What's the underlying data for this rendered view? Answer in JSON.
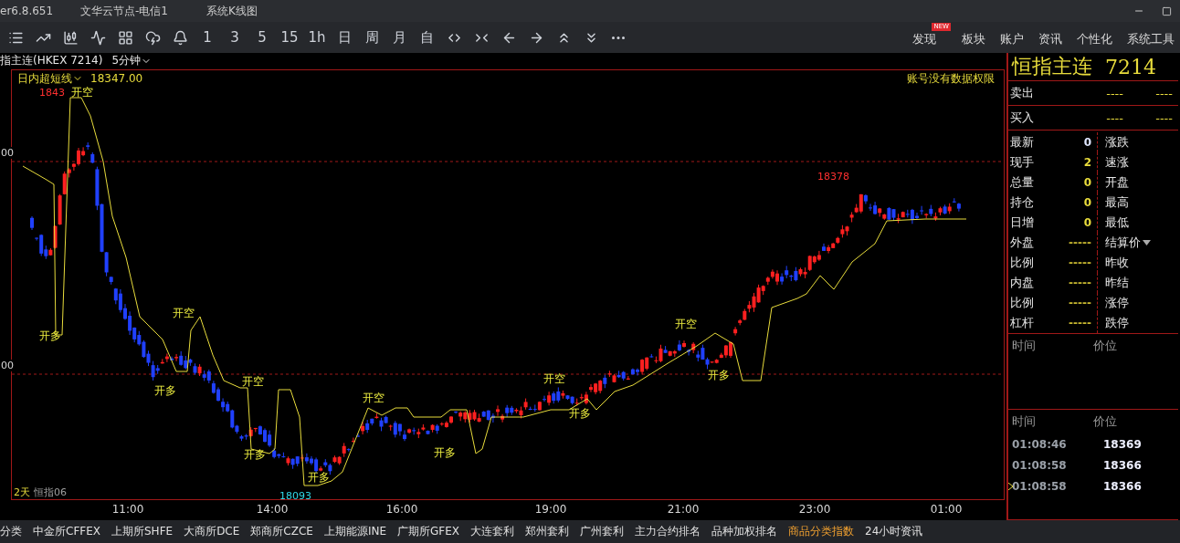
{
  "title_bar": {
    "version": "er6.8.651",
    "server": "文华云节点-电信1",
    "view": "系统K线图"
  },
  "toolbar": {
    "periods": [
      "1",
      "3",
      "5",
      "15",
      "1h",
      "日",
      "周",
      "月",
      "自"
    ],
    "menu": [
      {
        "label": "发现",
        "badge": "NEW"
      },
      {
        "label": "板块"
      },
      {
        "label": "账户"
      },
      {
        "label": "资讯"
      },
      {
        "label": "个性化"
      },
      {
        "label": "系统工具"
      }
    ]
  },
  "chart": {
    "symbol": "指主连(HKEX 7214)",
    "period": "5分钟",
    "indicator": "日内超短线",
    "indicator_value": "18347.00",
    "notice": "账号没有数据权限",
    "y_labels": [
      "00",
      "00"
    ],
    "price_marks": [
      {
        "label": "1843",
        "kind": "high"
      },
      {
        "label": "18378",
        "kind": "high"
      },
      {
        "label": "18093",
        "kind": "low"
      }
    ],
    "signals": [
      {
        "label": "开多"
      },
      {
        "label": "开空"
      },
      {
        "label": "开多"
      },
      {
        "label": "开空"
      },
      {
        "label": "开多"
      },
      {
        "label": "开空"
      },
      {
        "label": "开多"
      },
      {
        "label": "开空"
      },
      {
        "label": "开多"
      },
      {
        "label": "开空"
      },
      {
        "label": "开多"
      },
      {
        "label": "开空"
      },
      {
        "label": "开多"
      }
    ],
    "legend": [
      "2天",
      "恒指06"
    ],
    "x_labels": [
      "11:00",
      "14:00",
      "16:00",
      "19:00",
      "21:00",
      "23:00",
      "01:00"
    ]
  },
  "quote": {
    "name": "恒指主连",
    "code": "7214",
    "book": [
      {
        "label": "卖出",
        "values": [
          "----",
          "----"
        ]
      },
      {
        "label": "买入",
        "values": [
          "----",
          "----"
        ]
      }
    ],
    "stats": [
      {
        "label": "最新",
        "value": "0",
        "color": "#dfe6ff",
        "label2": "涨跌",
        "dropdown": false
      },
      {
        "label": "现手",
        "value": "2",
        "color": "#e8dc3c",
        "label2": "速涨",
        "dropdown": false
      },
      {
        "label": "总量",
        "value": "0",
        "color": "#e8dc3c",
        "label2": "开盘",
        "dropdown": false
      },
      {
        "label": "持仓",
        "value": "0",
        "color": "#e8dc3c",
        "label2": "最高",
        "dropdown": false
      },
      {
        "label": "日增",
        "value": "0",
        "color": "#e8dc3c",
        "label2": "最低",
        "dropdown": false
      },
      {
        "label": "外盘",
        "value": "-----",
        "color": "#c8b830",
        "label2": "结算价",
        "dropdown": true
      },
      {
        "label": "比例",
        "value": "-----",
        "color": "#c8b830",
        "label2": "昨收",
        "dropdown": false
      },
      {
        "label": "内盘",
        "value": "-----",
        "color": "#c8b830",
        "label2": "昨结",
        "dropdown": false
      },
      {
        "label": "比例",
        "value": "-----",
        "color": "#c8b830",
        "label2": "涨停",
        "dropdown": false
      },
      {
        "label": "杠杆",
        "value": "-----",
        "color": "#c8b830",
        "label2": "跌停",
        "dropdown": false
      }
    ],
    "orders_header": [
      "时间",
      "价位"
    ],
    "trades_header": [
      "时间",
      "价位"
    ],
    "trades": [
      {
        "time": "01:08:46",
        "price": "18369",
        "selected": false
      },
      {
        "time": "01:08:58",
        "price": "18366",
        "selected": false
      },
      {
        "time": "01:08:58",
        "price": "18366",
        "selected": true
      }
    ]
  },
  "bottom_tabs": [
    {
      "label": "分类",
      "selected": false
    },
    {
      "label": "中金所CFFEX",
      "selected": false
    },
    {
      "label": "上期所SHFE",
      "selected": false
    },
    {
      "label": "大商所DCE",
      "selected": false
    },
    {
      "label": "郑商所CZCE",
      "selected": false
    },
    {
      "label": "上期能源INE",
      "selected": false
    },
    {
      "label": "广期所GFEX",
      "selected": false
    },
    {
      "label": "大连套利",
      "selected": false
    },
    {
      "label": "郑州套利",
      "selected": false
    },
    {
      "label": "广州套利",
      "selected": false
    },
    {
      "label": "主力合约排名",
      "selected": false
    },
    {
      "label": "品种加权排名",
      "selected": false
    },
    {
      "label": "商品分类指数",
      "selected": true
    },
    {
      "label": "24小时资讯",
      "selected": false
    }
  ]
}
